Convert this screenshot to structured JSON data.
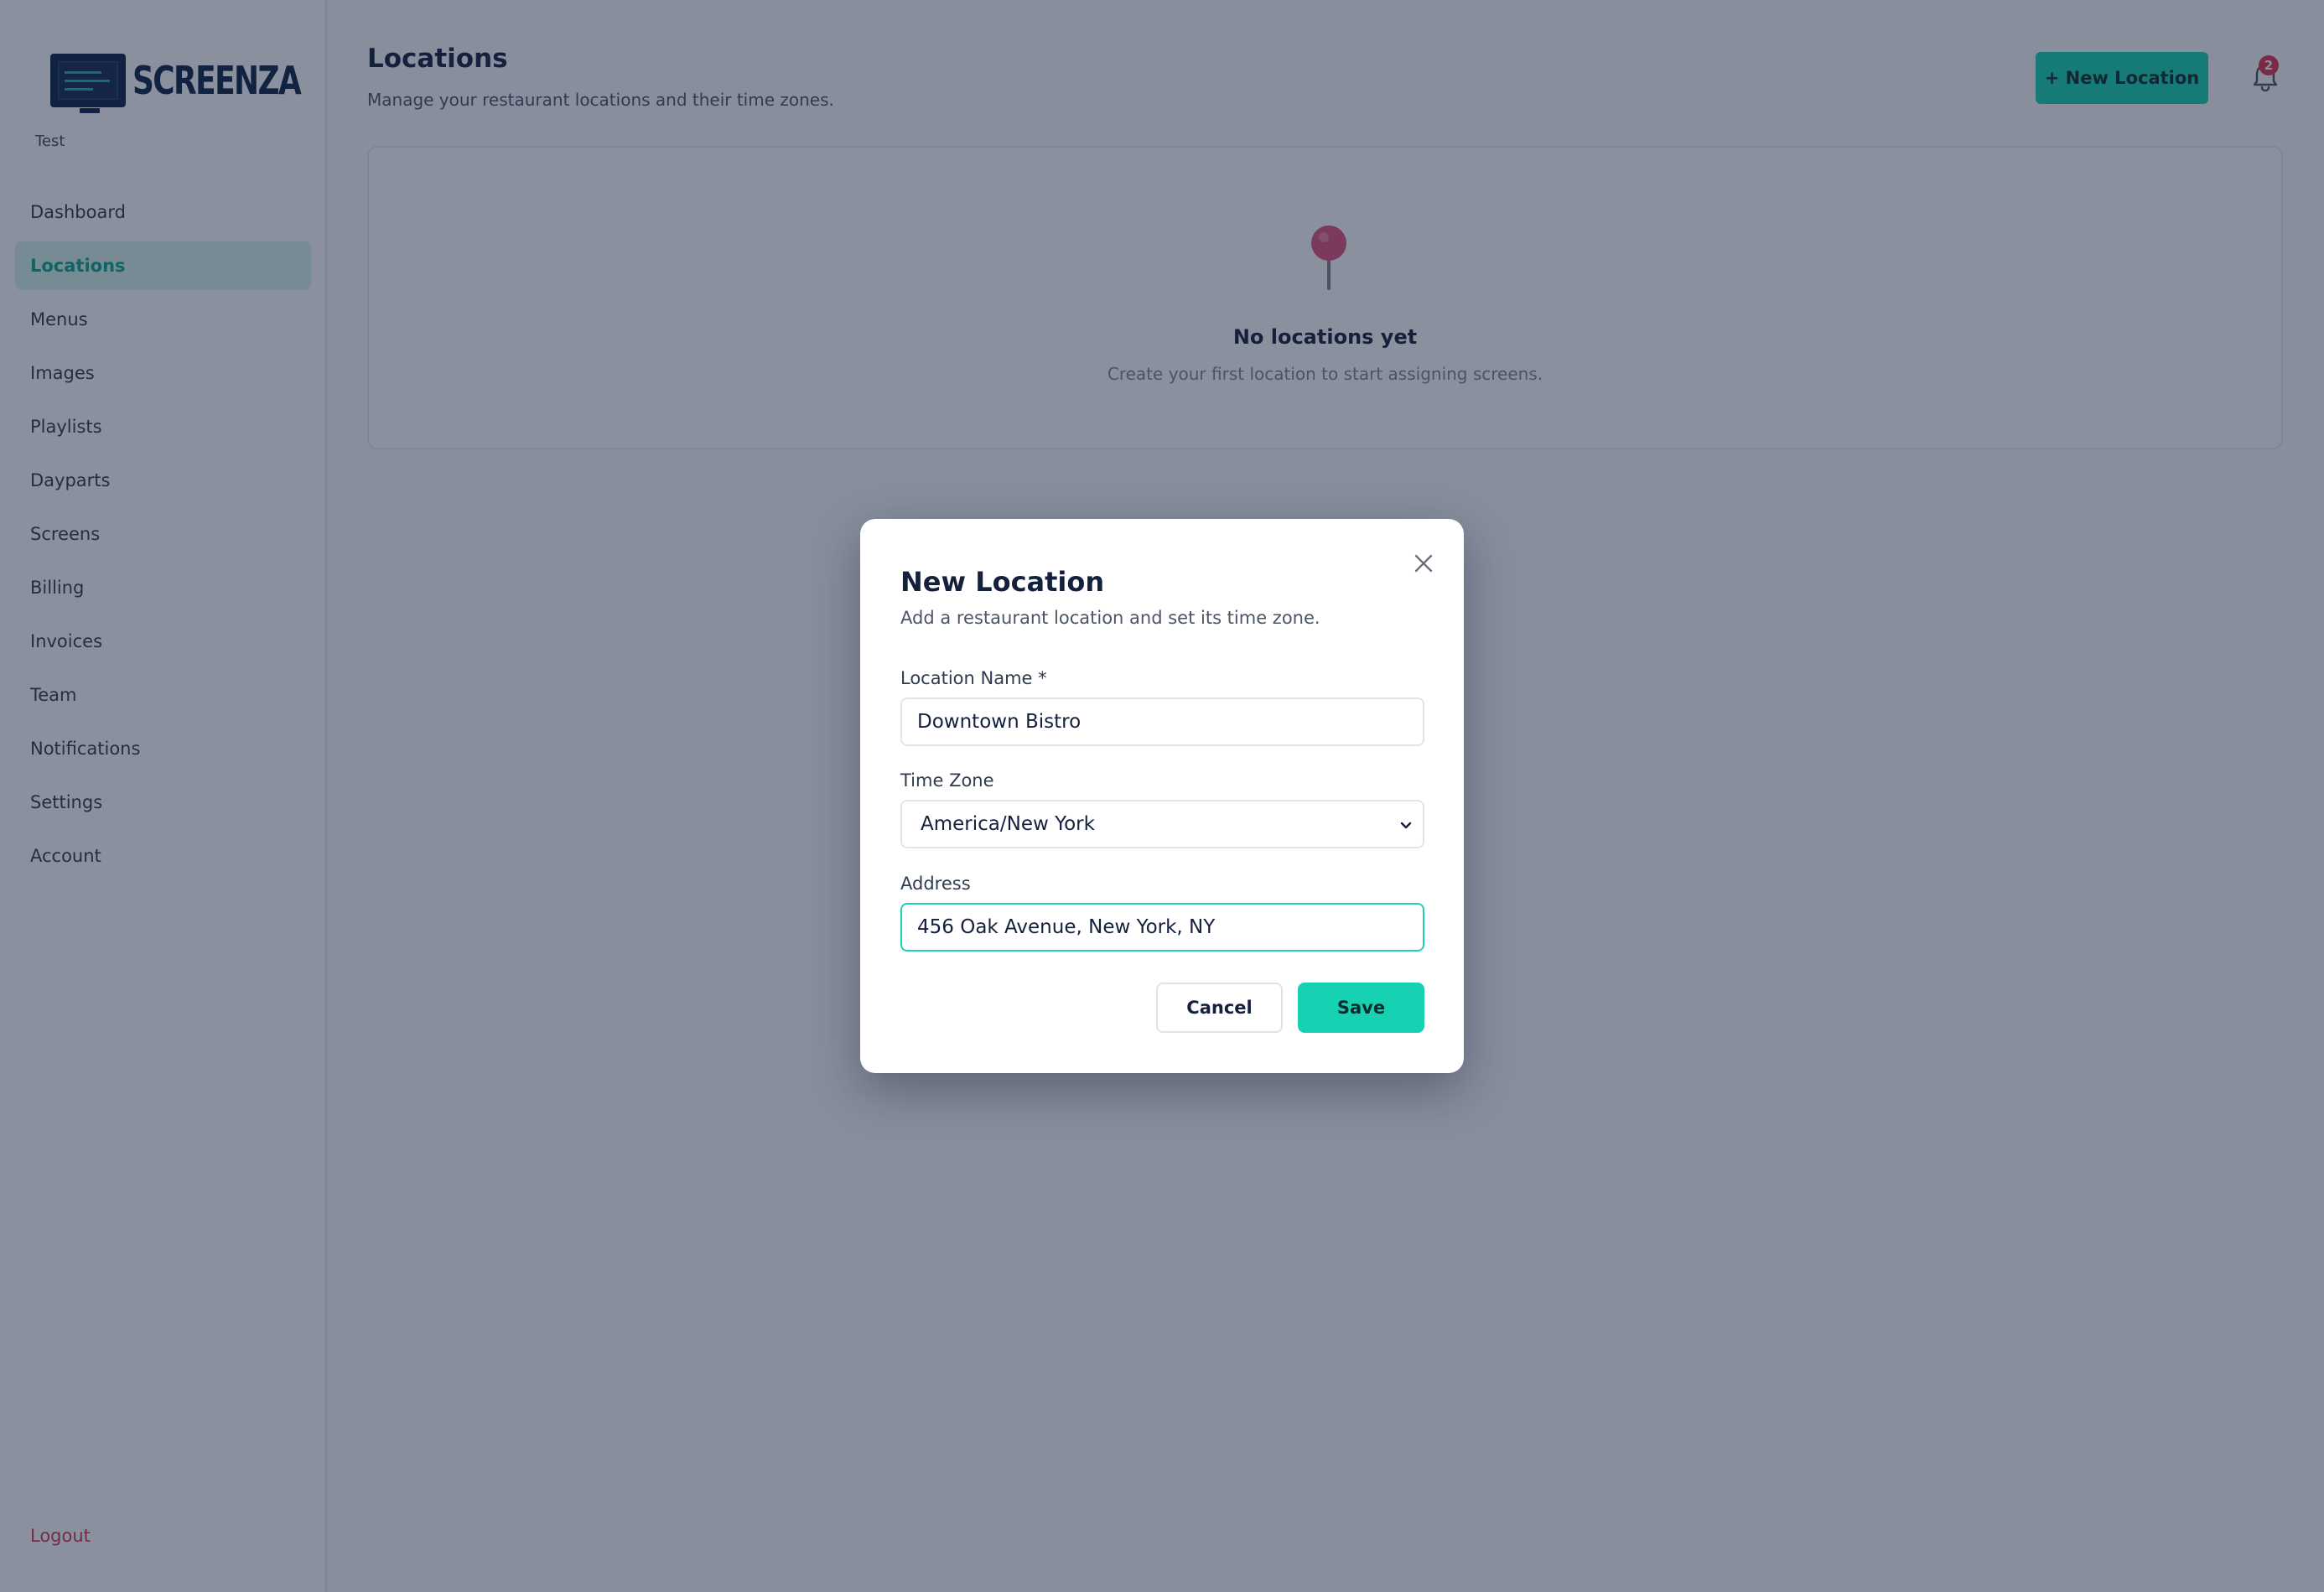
{
  "brand": {
    "name": "SCREENZA",
    "org": "Test"
  },
  "sidebar": {
    "items": [
      {
        "label": "Dashboard",
        "active": false
      },
      {
        "label": "Locations",
        "active": true
      },
      {
        "label": "Menus",
        "active": false
      },
      {
        "label": "Images",
        "active": false
      },
      {
        "label": "Playlists",
        "active": false
      },
      {
        "label": "Dayparts",
        "active": false
      },
      {
        "label": "Screens",
        "active": false
      },
      {
        "label": "Billing",
        "active": false
      },
      {
        "label": "Invoices",
        "active": false
      },
      {
        "label": "Team",
        "active": false
      },
      {
        "label": "Notifications",
        "active": false
      },
      {
        "label": "Settings",
        "active": false
      },
      {
        "label": "Account",
        "active": false
      }
    ],
    "logout_label": "Logout"
  },
  "header": {
    "title": "Locations",
    "subtitle": "Manage your restaurant locations and their time zones.",
    "new_button_label": "+ New Location",
    "notification_count": "2"
  },
  "empty_state": {
    "icon": "map-pin-icon",
    "title": "No locations yet",
    "subtitle": "Create your first location to start assigning screens."
  },
  "modal": {
    "title": "New Location",
    "subtitle": "Add a restaurant location and set its time zone.",
    "fields": {
      "name": {
        "label": "Location Name *",
        "value": "Downtown Bistro"
      },
      "timezone": {
        "label": "Time Zone",
        "value": "America/New York"
      },
      "address": {
        "label": "Address",
        "value": "456 Oak Avenue, New York, NY"
      }
    },
    "cancel_label": "Cancel",
    "save_label": "Save"
  },
  "colors": {
    "accent": "#16d2b3",
    "active_text": "#08a98a",
    "danger": "#d2325c",
    "navy": "#14213d"
  }
}
